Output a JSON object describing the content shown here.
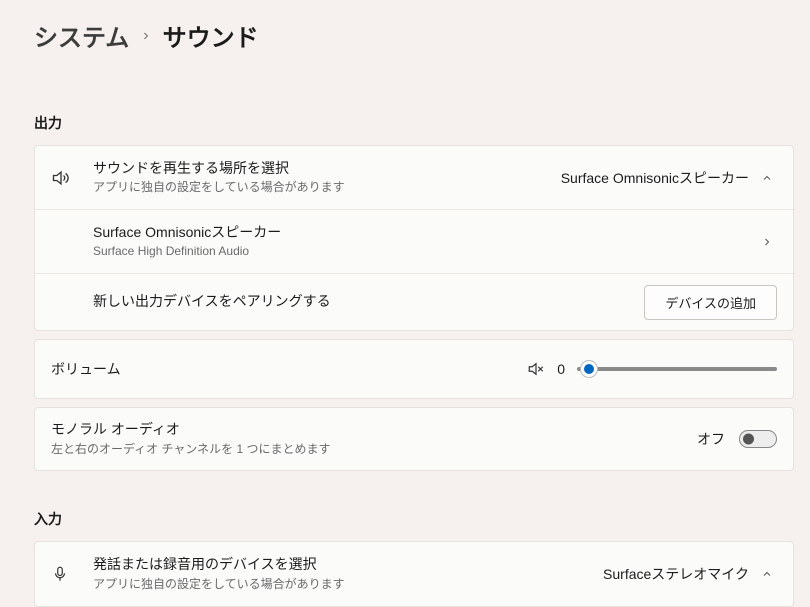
{
  "breadcrumb": {
    "level1": "システム",
    "sep": "›",
    "level2": "サウンド"
  },
  "sections": {
    "output": "出力",
    "input": "入力"
  },
  "output": {
    "selectDevice": {
      "title": "サウンドを再生する場所を選択",
      "subtitle": "アプリに独自の設定をしている場合があります",
      "current": "Surface Omnisonicスピーカー"
    },
    "device": {
      "name": "Surface Omnisonicスピーカー",
      "desc": "Surface High Definition Audio"
    },
    "pair": {
      "label": "新しい出力デバイスをペアリングする",
      "button": "デバイスの追加"
    },
    "volume": {
      "label": "ボリューム",
      "value": "0"
    },
    "mono": {
      "title": "モノラル オーディオ",
      "subtitle": "左と右のオーディオ チャンネルを 1 つにまとめます",
      "state": "オフ"
    }
  },
  "input": {
    "selectDevice": {
      "title": "発話または録音用のデバイスを選択",
      "subtitle": "アプリに独自の設定をしている場合があります",
      "current": "Surfaceステレオマイク"
    }
  }
}
